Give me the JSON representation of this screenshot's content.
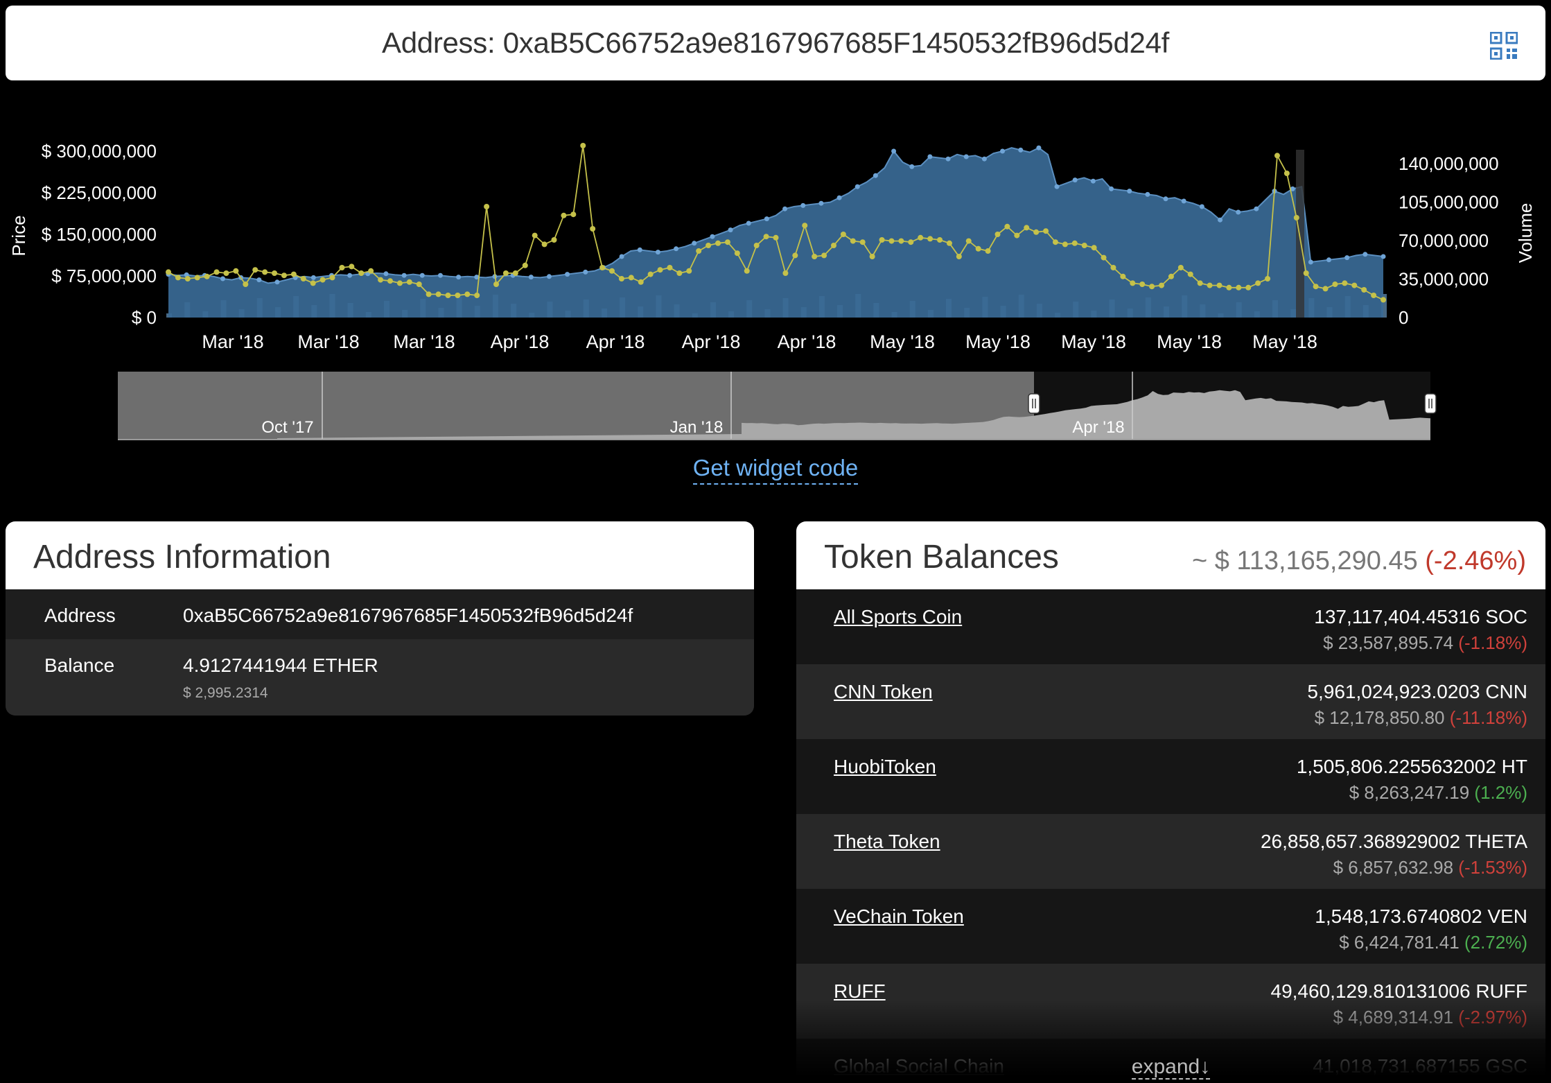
{
  "header": {
    "title": "Address: 0xaB5C66752a9e8167967685F1450532fB96d5d24f",
    "qr_icon": "qr-code-icon"
  },
  "chart_data": {
    "type": "area",
    "y_left_label": "Price",
    "y_right_label": "Volume",
    "y_left_ticks": [
      "$ 300,000,000",
      "$ 225,000,000",
      "$ 150,000,000",
      "$ 75,000,000",
      "$ 0"
    ],
    "y_right_ticks": [
      "140,000,000",
      "105,000,000",
      "70,000,000",
      "35,000,000",
      "0"
    ],
    "ylim_left": [
      0,
      300000000
    ],
    "ylim_right": [
      0,
      140000000
    ],
    "x_ticks": [
      "Mar '18",
      "Mar '18",
      "Mar '18",
      "Apr '18",
      "Apr '18",
      "Apr '18",
      "Apr '18",
      "May '18",
      "May '18",
      "May '18",
      "May '18",
      "May '18"
    ],
    "series": [
      {
        "type": "area",
        "color": "#3a6a96",
        "values": [
          78,
          76,
          77,
          75,
          76,
          74,
          70,
          68,
          72,
          71,
          68,
          62,
          64,
          68,
          72,
          74,
          72,
          74,
          76,
          77,
          76,
          78,
          79,
          80,
          79,
          77,
          76,
          78,
          76,
          75,
          76,
          74,
          73,
          74,
          73,
          72,
          74,
          75,
          76,
          74,
          73,
          72,
          74,
          76,
          78,
          80,
          82,
          84,
          90,
          98,
          110,
          120,
          122,
          120,
          118,
          120,
          124,
          128,
          134,
          140,
          146,
          152,
          158,
          166,
          170,
          174,
          178,
          184,
          196,
          200,
          202,
          204,
          206,
          208,
          216,
          224,
          236,
          244,
          256,
          270,
          300,
          280,
          272,
          274,
          290,
          288,
          286,
          294,
          290,
          292,
          286,
          296,
          300,
          306,
          302,
          298,
          306,
          294,
          236,
          242,
          248,
          252,
          246,
          250,
          232,
          230,
          228,
          224,
          222,
          220,
          214,
          216,
          210,
          206,
          200,
          190,
          176,
          196,
          190,
          192,
          196,
          212,
          228,
          222,
          232,
          236,
          100,
          102,
          104,
          106,
          108,
          112,
          114,
          112,
          110
        ]
      },
      {
        "type": "line",
        "color": "#c5c14a",
        "values": [
          82,
          72,
          70,
          72,
          74,
          82,
          80,
          84,
          60,
          86,
          82,
          80,
          76,
          78,
          70,
          62,
          68,
          72,
          90,
          92,
          80,
          84,
          68,
          66,
          62,
          64,
          60,
          42,
          42,
          40,
          40,
          42,
          40,
          200,
          60,
          80,
          80,
          94,
          148,
          132,
          140,
          184,
          186,
          310,
          160,
          90,
          84,
          70,
          72,
          64,
          78,
          86,
          90,
          80,
          84,
          120,
          130,
          134,
          136,
          116,
          84,
          130,
          146,
          144,
          80,
          112,
          166,
          110,
          112,
          130,
          150,
          138,
          136,
          110,
          140,
          138,
          138,
          136,
          144,
          142,
          140,
          134,
          110,
          138,
          124,
          120,
          150,
          164,
          148,
          162,
          154,
          156,
          136,
          132,
          134,
          130,
          126,
          108,
          90,
          74,
          62,
          60,
          56,
          58,
          74,
          90,
          78,
          62,
          58,
          58,
          54,
          54,
          54,
          62,
          70,
          292,
          260,
          180,
          80,
          56,
          52,
          60,
          62,
          58,
          50,
          40,
          32
        ]
      }
    ],
    "navigator_ticks": [
      "Oct '17",
      "Jan '18",
      "Apr '18"
    ]
  },
  "widget": {
    "label": "Get widget code"
  },
  "address_info": {
    "title": "Address Information",
    "rows": [
      {
        "key": "Address",
        "value": "0xaB5C66752a9e8167967685F1450532fB96d5d24f",
        "sub": ""
      },
      {
        "key": "Balance",
        "value": "4.9127441944 ETHER",
        "sub": "$ 2,995.2314"
      }
    ]
  },
  "token_balances": {
    "title": "Token Balances",
    "total": "~ $ 113,165,290.45",
    "total_change": "(-2.46%)",
    "tokens": [
      {
        "name": "All Sports Coin",
        "amount": "137,117,404.45316 SOC",
        "usd": "$ 23,587,895.74",
        "change": "(-1.18%)",
        "dir": "neg"
      },
      {
        "name": "CNN Token",
        "amount": "5,961,024,923.0203 CNN",
        "usd": "$ 12,178,850.80",
        "change": "(-11.18%)",
        "dir": "neg"
      },
      {
        "name": "HuobiToken",
        "amount": "1,505,806.2255632002 HT",
        "usd": "$ 8,263,247.19",
        "change": "(1.2%)",
        "dir": "pos"
      },
      {
        "name": "Theta Token",
        "amount": "26,858,657.368929002 THETA",
        "usd": "$ 6,857,632.98",
        "change": "(-1.53%)",
        "dir": "neg"
      },
      {
        "name": "VeChain Token",
        "amount": "1,548,173.6740802 VEN",
        "usd": "$ 6,424,781.41",
        "change": "(2.72%)",
        "dir": "pos"
      },
      {
        "name": "RUFF",
        "amount": "49,460,129.810131006 RUFF",
        "usd": "$ 4,689,314.91",
        "change": "(-2.97%)",
        "dir": "neg"
      },
      {
        "name": "Global Social Chain",
        "amount": "41,018,731.687155 GSC",
        "usd": "",
        "change": "",
        "dir": ""
      }
    ],
    "expand_label": "expand↓"
  }
}
